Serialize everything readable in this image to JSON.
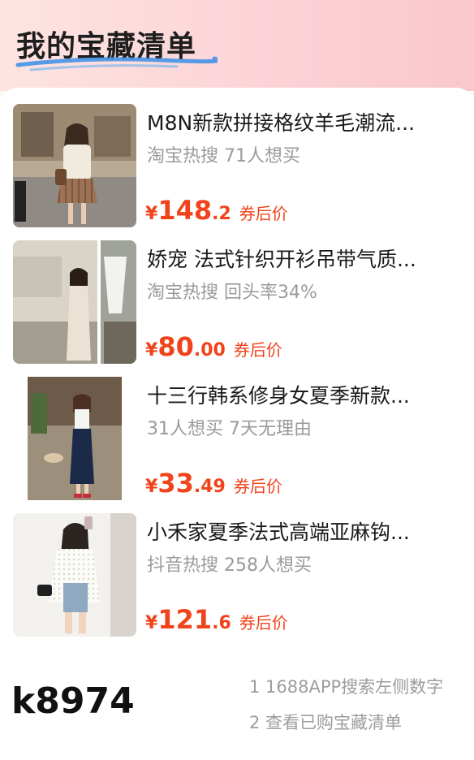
{
  "header": {
    "title": "我的宝藏清单"
  },
  "colors": {
    "price": "#f0431b",
    "subtitle": "#9a9a9a",
    "accent_line": "#3a8ee6"
  },
  "items": [
    {
      "title": "M8N新款拼接格纹羊毛潮流...",
      "subtitle": "淘宝热搜 71人想买",
      "price_symbol": "¥",
      "price_int": "148",
      "price_dec": ".2",
      "price_tag": "券后价",
      "image": "woman-in-cream-cardigan-plaid-skirt"
    },
    {
      "title": "娇宠 法式针织开衫吊带气质...",
      "subtitle": "淘宝热搜 回头率34%",
      "price_symbol": "¥",
      "price_int": "80",
      "price_dec": ".00",
      "price_tag": "券后价",
      "image": "woman-in-knit-dress-collage"
    },
    {
      "title": "十三行韩系修身女夏季新款...",
      "subtitle": "31人想买 7天无理由",
      "price_symbol": "¥",
      "price_int": "33",
      "price_dec": ".49",
      "price_tag": "券后价",
      "image": "woman-in-white-top-navy-skirt"
    },
    {
      "title": "小禾家夏季法式高端亚麻钩...",
      "subtitle": "抖音热搜 258人想买",
      "price_symbol": "¥",
      "price_int": "121",
      "price_dec": ".6",
      "price_tag": "券后价",
      "image": "woman-in-crochet-cardigan-denim-shorts"
    }
  ],
  "footer": {
    "code": "k8974",
    "hint_1": "1 1688APP搜索左侧数字",
    "hint_2": "2 查看已购宝藏清单"
  }
}
